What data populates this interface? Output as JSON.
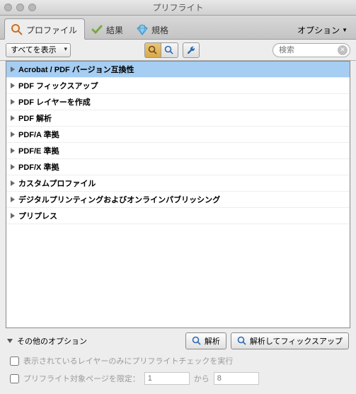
{
  "window": {
    "title": "プリフライト"
  },
  "tabs": {
    "profile": "プロファイル",
    "results": "結果",
    "standards": "規格",
    "options": "オプション"
  },
  "toolbar": {
    "filter": "すべてを表示",
    "search_placeholder": "検索"
  },
  "list": {
    "items": [
      {
        "label": "Acrobat / PDF バージョン互換性"
      },
      {
        "label": "PDF フィックスアップ"
      },
      {
        "label": "PDF レイヤーを作成"
      },
      {
        "label": "PDF 解析"
      },
      {
        "label": "PDF/A 準拠"
      },
      {
        "label": "PDF/E 準拠"
      },
      {
        "label": "PDF/X 準拠"
      },
      {
        "label": "カスタムプロファイル"
      },
      {
        "label": "デジタルプリンティングおよびオンラインパブリッシング"
      },
      {
        "label": "プリプレス"
      }
    ],
    "selected_index": 0
  },
  "footer": {
    "other_options": "その他のオプション",
    "analyze": "解析",
    "analyze_fix": "解析してフィックスアップ",
    "check_layers": "表示されているレイヤーのみにプリフライトチェックを実行",
    "limit_pages": "プリフライト対象ページを限定：",
    "page_from": "1",
    "page_to_label": "から",
    "page_to": "8"
  }
}
